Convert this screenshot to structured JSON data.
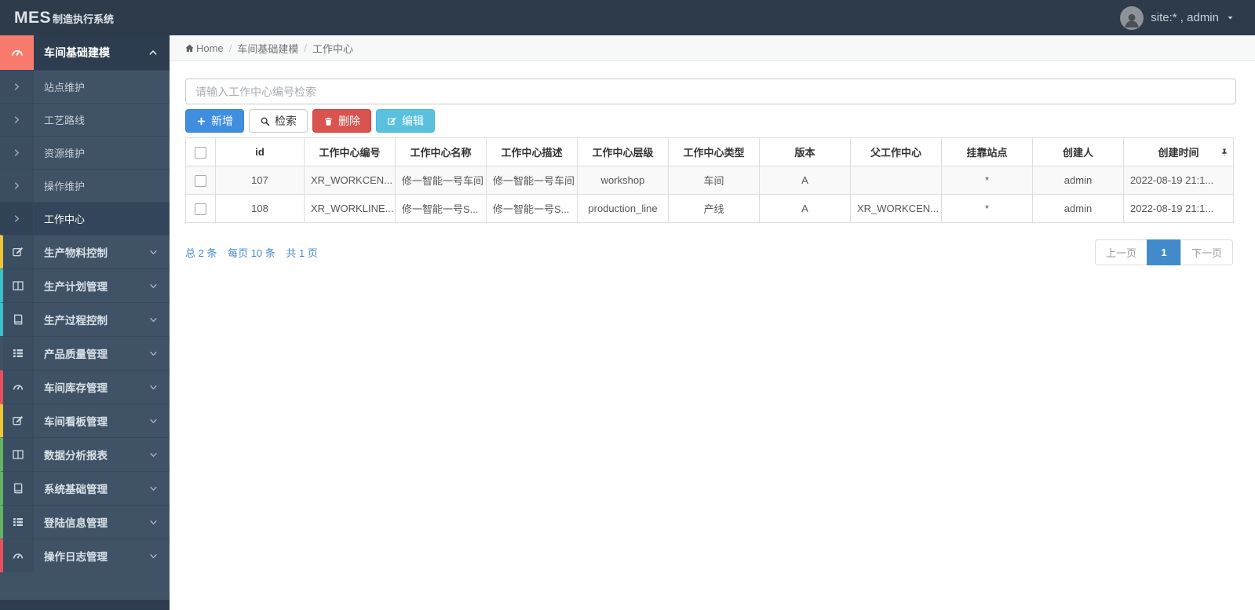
{
  "navbar": {
    "brand_bold": "MES",
    "brand_text": "制造执行系统",
    "user_label": "site:* , admin",
    "avatar_icon": "user-avatar-icon",
    "caret_icon": "caret-down-icon"
  },
  "sidebar": {
    "group": {
      "label": "车间基础建模",
      "icon": "gauge-icon",
      "accent": "#f87a6d",
      "chevron": "chevron-up-icon",
      "children": [
        {
          "label": "站点维护"
        },
        {
          "label": "工艺路线"
        },
        {
          "label": "资源维护"
        },
        {
          "label": "操作维护"
        },
        {
          "label": "工作中心",
          "active": true
        }
      ]
    },
    "items": [
      {
        "label": "生产物料控制",
        "icon": "edit-square-icon",
        "accent": "#edc537"
      },
      {
        "label": "生产计划管理",
        "icon": "columns-icon",
        "accent": "#3bc0c3"
      },
      {
        "label": "生产过程控制",
        "icon": "book-icon",
        "accent": "#3bc0c3"
      },
      {
        "label": "产品质量管理",
        "icon": "list-icon",
        "accent": ""
      },
      {
        "label": "车间库存管理",
        "icon": "gauge-icon",
        "accent": "#e7505a"
      },
      {
        "label": "车间看板管理",
        "icon": "edit-square-icon",
        "accent": "#edc537"
      },
      {
        "label": "数据分析报表",
        "icon": "columns-icon",
        "accent": "#62b462"
      },
      {
        "label": "系统基础管理",
        "icon": "book-icon",
        "accent": "#62b462"
      },
      {
        "label": "登陆信息管理",
        "icon": "list-icon",
        "accent": "#62b462"
      },
      {
        "label": "操作日志管理",
        "icon": "gauge-icon",
        "accent": "#e7505a"
      }
    ]
  },
  "breadcrumb": {
    "home_icon": "home-icon",
    "home_label": "Home",
    "separator": "/",
    "items": [
      "车间基础建模",
      "工作中心"
    ]
  },
  "toolbar": {
    "search_placeholder": "请输入工作中心编号检索",
    "buttons": [
      {
        "label": "新增",
        "icon": "plus-icon",
        "style": "primary"
      },
      {
        "label": "检索",
        "icon": "search-icon",
        "style": "default"
      },
      {
        "label": "删除",
        "icon": "trash-icon",
        "style": "danger"
      },
      {
        "label": "编辑",
        "icon": "edit-icon",
        "style": "info"
      }
    ]
  },
  "table": {
    "pin_icon": "pin-icon",
    "columns": [
      "id",
      "工作中心编号",
      "工作中心名称",
      "工作中心描述",
      "工作中心层级",
      "工作中心类型",
      "版本",
      "父工作中心",
      "挂靠站点",
      "创建人",
      "创建时间"
    ],
    "rows": [
      [
        "107",
        "XR_WORKCEN...",
        "修一智能一号车间",
        "修一智能一号车间",
        "workshop",
        "车间",
        "A",
        "",
        "*",
        "admin",
        "2022-08-19 21:1..."
      ],
      [
        "108",
        "XR_WORKLINE...",
        "修一智能一号S...",
        "修一智能一号S...",
        "production_line",
        "产线",
        "A",
        "XR_WORKCEN...",
        "*",
        "admin",
        "2022-08-19 21:1..."
      ]
    ]
  },
  "pagination": {
    "summary": [
      "总 2 条",
      "每页 10 条",
      "共 1 页"
    ],
    "prev_label": "上一页",
    "current_page": "1",
    "next_label": "下一页"
  },
  "colors": {
    "navbar_bg": "#2d3b4b",
    "sidebar_bg": "#3f5266",
    "group_accent": "#f87a6d",
    "primary": "#3f8edf",
    "danger": "#d9534f",
    "info": "#5bc0de",
    "pagination_active": "#428bca"
  }
}
